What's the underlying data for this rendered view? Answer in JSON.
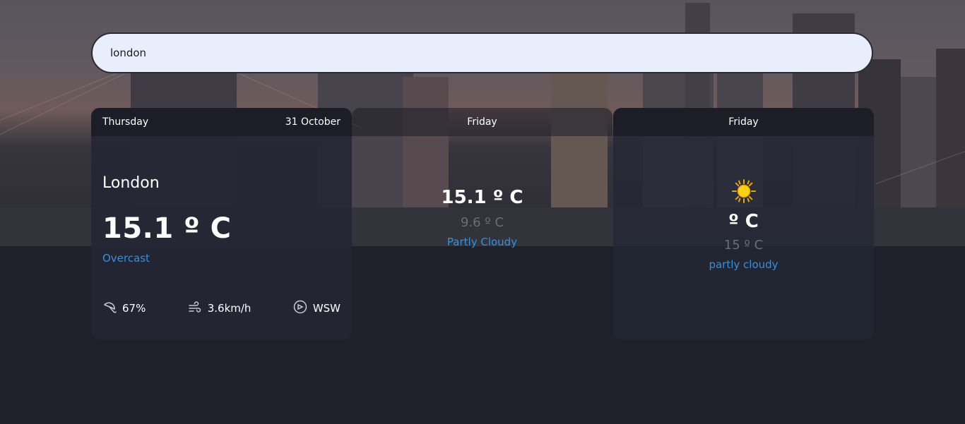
{
  "search": {
    "value": "london"
  },
  "today": {
    "day": "Thursday",
    "date": "31 October",
    "city": "London",
    "temperature": "15.1 º C",
    "condition": "Overcast",
    "humidity": "67%",
    "wind_speed": "3.6km/h",
    "wind_direction": "WSW"
  },
  "forecast": [
    {
      "day": "Friday",
      "max": "15.1 º C",
      "min": "9.6 º C",
      "condition": "Partly Cloudy"
    },
    {
      "day": "Friday",
      "max": "º C",
      "min": "15 º C",
      "condition": "partly cloudy",
      "icon": "sun-icon"
    }
  ],
  "colors": {
    "accent": "#3a8fd6",
    "background": "#1f202a",
    "card_header": "#1c1d27",
    "search_bg": "#e8eefb"
  }
}
